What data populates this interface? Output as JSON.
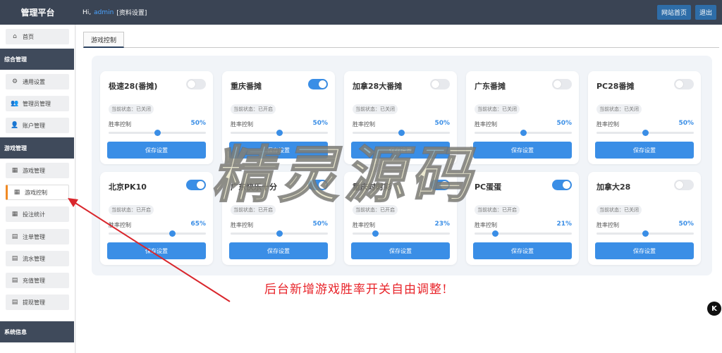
{
  "header": {
    "brand": "管理平台",
    "greeting": "Hi,",
    "user": "admin",
    "profile_link": "[资料设置]",
    "site_home": "网站首页",
    "logout": "退出"
  },
  "sidebar": {
    "home": "首页",
    "section_general": "综合管理",
    "general_items": [
      "通用设置",
      "管理员管理",
      "账户管理"
    ],
    "section_game": "游戏管理",
    "game_items": [
      "游戏管理",
      "游戏控制",
      "投注统计",
      "注单管理",
      "流水管理",
      "充值管理",
      "提现管理"
    ],
    "section_system": "系统信息"
  },
  "tab": {
    "label": "游戏控制"
  },
  "labels": {
    "rate": "胜率控制",
    "save": "保存设置"
  },
  "games": [
    {
      "name": "极速28(番摊)",
      "on": false,
      "status": "当前状态：已关闭",
      "rate": "50%",
      "level": 0.5
    },
    {
      "name": "重庆番摊",
      "on": true,
      "status": "当前状态：已开启",
      "rate": "50%",
      "level": 0.5
    },
    {
      "name": "加拿28大番摊",
      "on": false,
      "status": "当前状态：已关闭",
      "rate": "50%",
      "level": 0.5
    },
    {
      "name": "广东番摊",
      "on": false,
      "status": "当前状态：已关闭",
      "rate": "50%",
      "level": 0.5
    },
    {
      "name": "PC28番摊",
      "on": false,
      "status": "当前状态：已关闭",
      "rate": "50%",
      "level": 0.5
    },
    {
      "name": "北京PK10",
      "on": true,
      "status": "当前状态：已开启",
      "rate": "65%",
      "level": 0.65
    },
    {
      "name": "广东快乐十分",
      "on": true,
      "status": "当前状态：已开启",
      "rate": "50%",
      "level": 0.5
    },
    {
      "name": "重庆时时彩",
      "on": true,
      "status": "当前状态：已开启",
      "rate": "23%",
      "level": 0.23
    },
    {
      "name": "PC蛋蛋",
      "on": true,
      "status": "当前状态：已开启",
      "rate": "21%",
      "level": 0.21
    },
    {
      "name": "加拿大28",
      "on": false,
      "status": "当前状态：已关闭",
      "rate": "50%",
      "level": 0.5
    }
  ],
  "watermark": "精灵源码",
  "caption": "后台新增游戏胜率开关自由调整!",
  "colors": {
    "accent": "#3a8ee6",
    "header": "#3a4454",
    "section": "#3f4a5b",
    "active_marker": "#f08a24",
    "caption": "#e8242a"
  }
}
